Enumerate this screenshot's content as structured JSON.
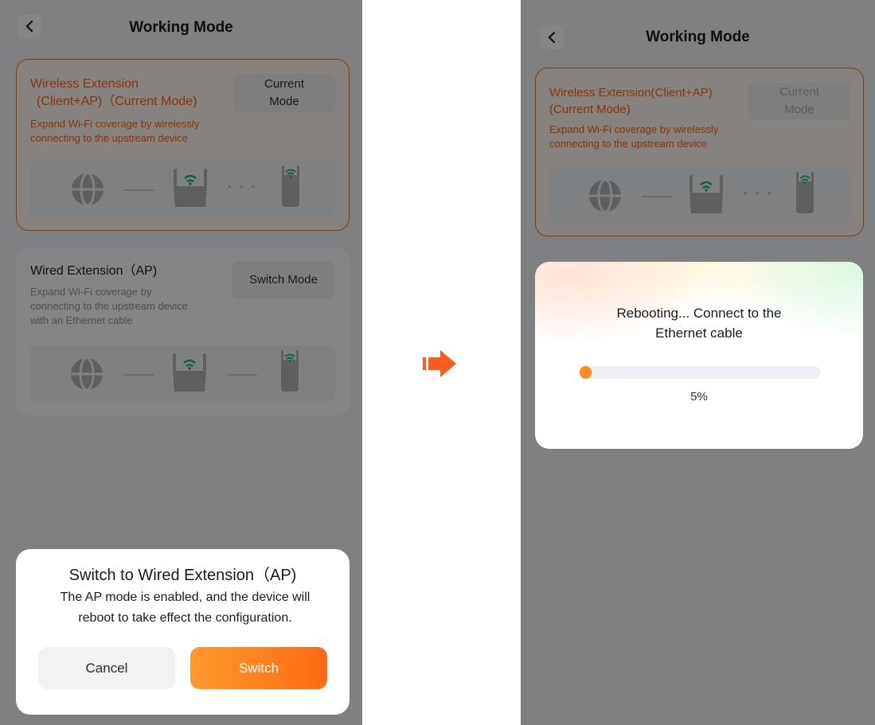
{
  "left": {
    "title": "Working Mode",
    "wireless_card": {
      "title_line1": "Wireless Extension",
      "title_line2": "(Client+AP)（Current Mode)",
      "desc_line1": "Expand Wi-Fi coverage by wirelessly",
      "desc_line2": "connecting to the upstream device",
      "button_line1": "Current",
      "button_line2": "Mode"
    },
    "wired_card": {
      "title": "Wired Extension（AP)",
      "desc_line1": "Expand Wi-Fi coverage by",
      "desc_line2": "connecting to the upstream device",
      "desc_line3": "with an Ethernet cable",
      "button": "Switch Mode"
    },
    "dialog": {
      "title": "Switch to Wired Extension（AP)",
      "message_line1": "The AP mode is enabled, and the device will",
      "message_line2": "reboot to take effect the configuration.",
      "cancel": "Cancel",
      "confirm": "Switch"
    }
  },
  "right": {
    "title": "Working Mode",
    "wireless_card": {
      "title_line1": "Wireless Extension(Client+AP)",
      "title_line2": "(Current Mode)",
      "desc_line1": "Expand Wi-Fi coverage by wirelessly",
      "desc_line2": "connecting to the upstream device",
      "button_line1": "Current",
      "button_line2": "Mode"
    },
    "reboot": {
      "message_line1": "Rebooting... Connect to the",
      "message_line2": "Ethernet cable",
      "progress_percent": 5,
      "progress_text": "5%"
    }
  },
  "colors": {
    "accent": "#ff6a13",
    "wifi_green": "#2bb673",
    "arrow": "#ff5a1f"
  },
  "icons": {
    "back": "chevron-left-icon",
    "internet": "globe-icon",
    "router": "router-icon",
    "extender": "extender-icon",
    "transition": "arrow-right-icon"
  }
}
